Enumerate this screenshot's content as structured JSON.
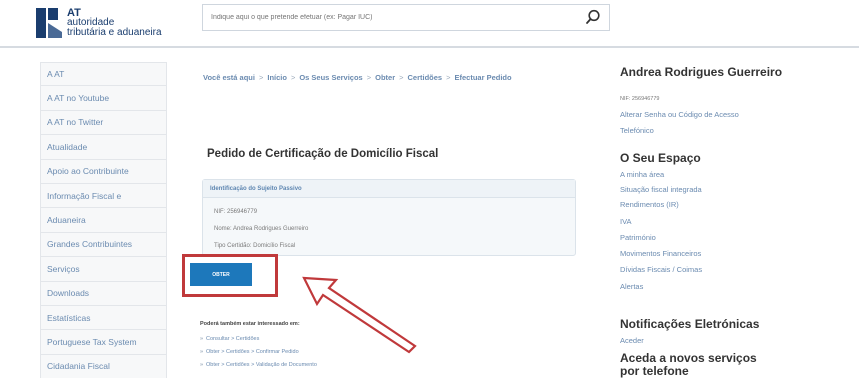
{
  "header": {
    "logo_line1": "AT",
    "logo_line2": "autoridade",
    "logo_line3": "tributária e aduaneira",
    "search_placeholder": "Indique aqui o que pretende efetuar (ex: Pagar IUC)",
    "search_icon": "search-icon"
  },
  "sidebar": {
    "items": [
      "A AT",
      "A AT no Youtube",
      "A AT no Twitter",
      "Atualidade",
      "Apoio ao Contribuinte",
      "Informação Fiscal e",
      "Aduaneira",
      "Grandes Contribuintes",
      "Serviços",
      "Downloads",
      "Estatísticas",
      "Portuguese Tax System",
      "Cidadania Fiscal"
    ]
  },
  "breadcrumb": {
    "prefix": "Você está aqui",
    "items": [
      "Início",
      "Os Seus Serviços",
      "Obter",
      "Certidões",
      "Efectuar Pedido"
    ]
  },
  "main": {
    "title": "Pedido de Certificação de Domicílio Fiscal",
    "id_box_head": "Identificação do Sujeito Passivo",
    "nif_line": "NIF: 256946779",
    "name_line": "Nome: Andrea Rodrigues Guerreiro",
    "tipo_line": "Tipo Certidão: Domicílio Fiscal",
    "obter_button": "OBTER",
    "also_interested": "Poderá também estar interessado em:",
    "links": [
      "Consultar > Certidões",
      "Obter > Certidões > Confirmar Pedido",
      "Obter > Certidões > Validação de Documento"
    ]
  },
  "right": {
    "user_name": "Andrea Rodrigues Guerreiro",
    "nif": "NIF: 256946779",
    "change_password": "Alterar Senha ou Código de Acesso",
    "telefonico": "Telefónico",
    "espaco_head": "O Seu Espaço",
    "espaco_links": [
      "A minha área",
      "Situação fiscal integrada",
      "Rendimentos (IR)",
      "IVA",
      "Património",
      "Movimentos Financeiros",
      "Dívidas Fiscais / Coimas",
      "Alertas"
    ],
    "notif_head": "Notificações Eletrónicas",
    "notif_link": "Aceder",
    "phone_head_line1": "Aceda a novos serviços",
    "phone_head_line2": "por telefone"
  },
  "colors": {
    "accent_blue": "#1d78bb",
    "link_blue": "#6b8bb0",
    "highlight_red": "#c0393b",
    "brand_navy": "#1a3d6e"
  }
}
